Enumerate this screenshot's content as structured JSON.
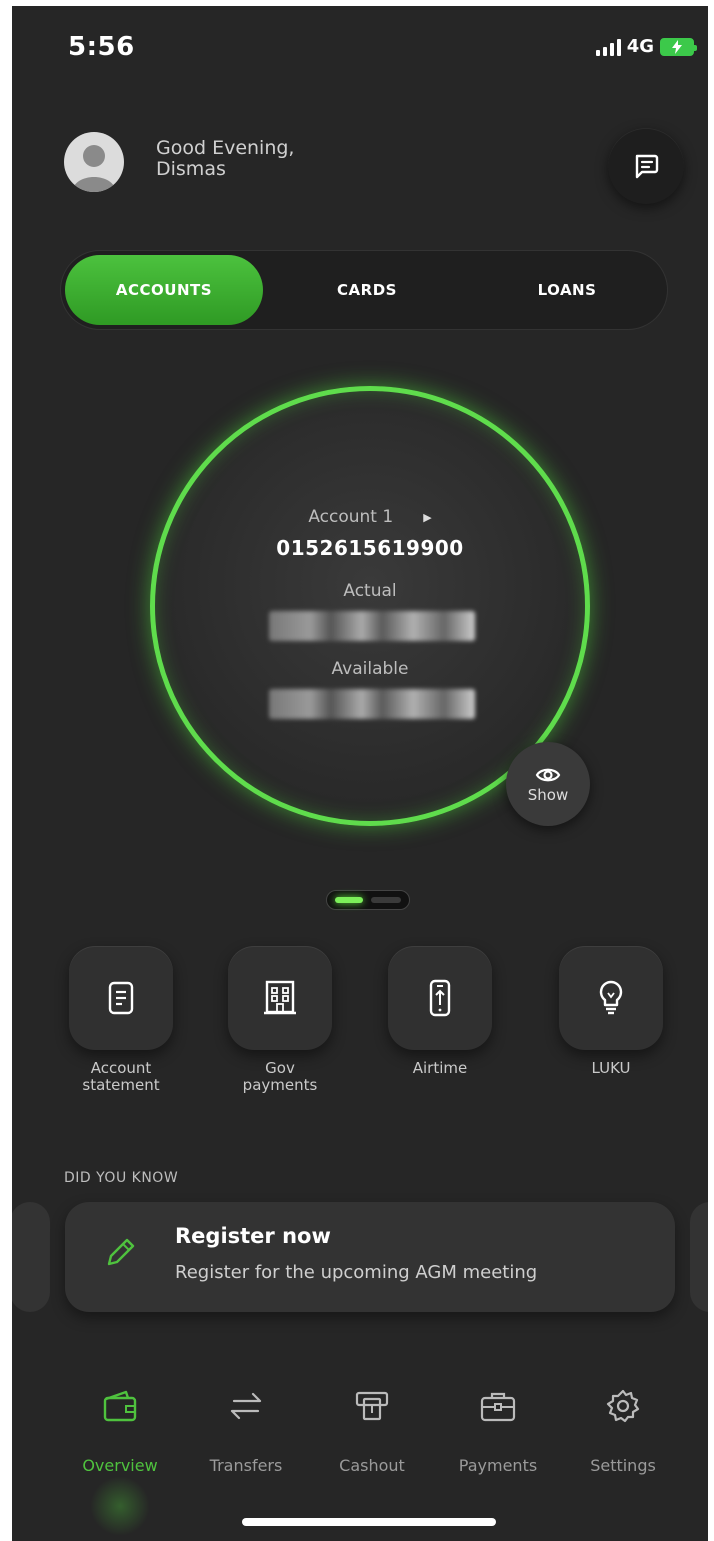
{
  "status_bar": {
    "time": "5:56",
    "network": "4G"
  },
  "header": {
    "greeting_line1": "Good Evening,",
    "greeting_line2": "Dismas"
  },
  "tabs": [
    {
      "label": "ACCOUNTS",
      "active": true
    },
    {
      "label": "CARDS",
      "active": false
    },
    {
      "label": "LOANS",
      "active": false
    }
  ],
  "account": {
    "name": "Account 1",
    "number": "0152615619900",
    "actual_label": "Actual",
    "available_label": "Available",
    "show_label": "Show"
  },
  "quick_actions": [
    {
      "line1": "Account",
      "line2": "statement",
      "icon": "document-icon"
    },
    {
      "line1": "Gov",
      "line2": "payments",
      "icon": "building-icon"
    },
    {
      "line1": "Airtime",
      "line2": "",
      "icon": "phone-topup-icon"
    },
    {
      "line1": "LUKU",
      "line2": "",
      "icon": "lightbulb-icon"
    }
  ],
  "did_you_know": {
    "heading": "DID YOU KNOW",
    "title": "Register now",
    "subtitle": "Register for the upcoming AGM meeting"
  },
  "bottom_nav": [
    {
      "label": "Overview",
      "icon": "wallet-icon",
      "active": true
    },
    {
      "label": "Transfers",
      "icon": "transfer-arrows-icon",
      "active": false
    },
    {
      "label": "Cashout",
      "icon": "atm-icon",
      "active": false
    },
    {
      "label": "Payments",
      "icon": "briefcase-icon",
      "active": false
    },
    {
      "label": "Settings",
      "icon": "gear-icon",
      "active": false
    }
  ],
  "colors": {
    "accent": "#4fc23e",
    "background": "#262626",
    "ring": "#5fdc4c"
  }
}
